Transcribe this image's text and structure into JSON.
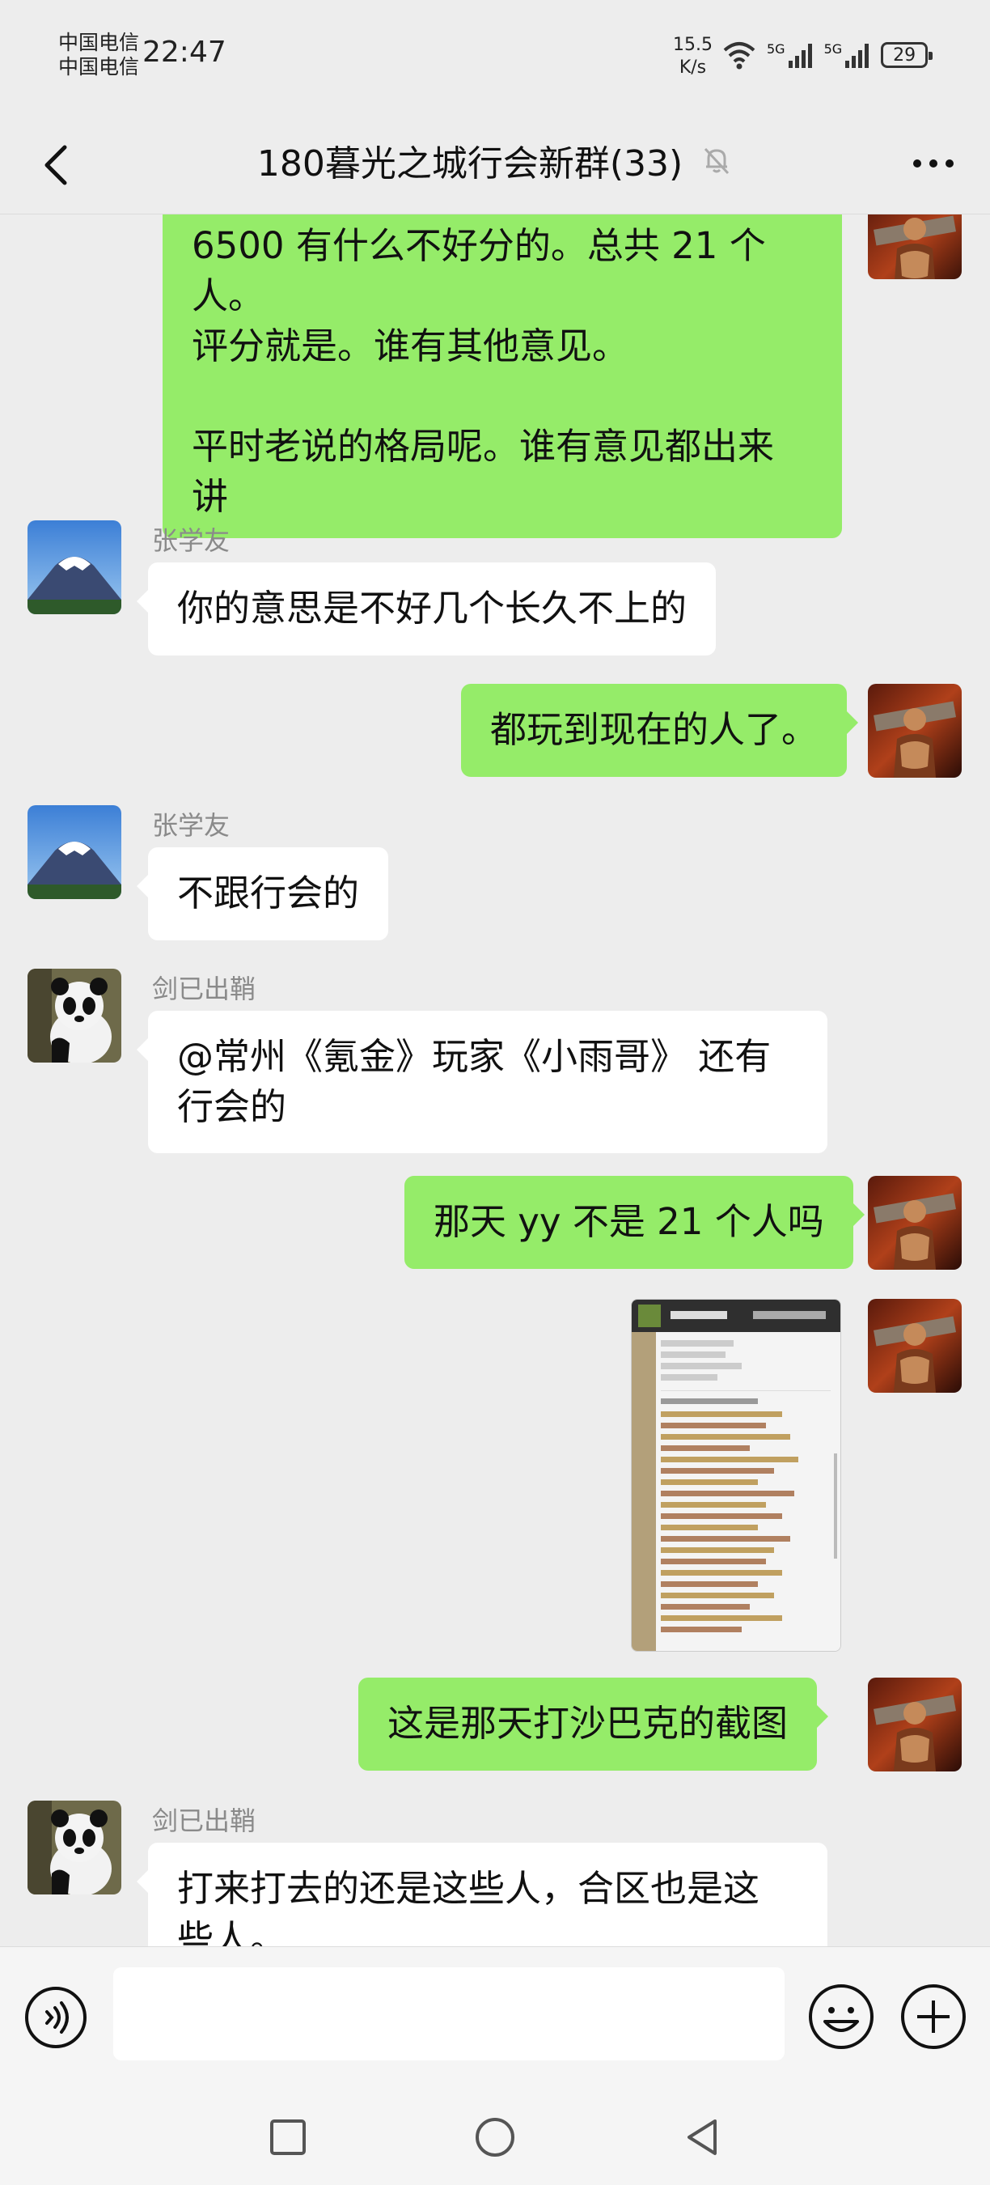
{
  "status_bar": {
    "carrier_1": "中国电信",
    "carrier_2": "中国电信",
    "time": "22:47",
    "net_speed_value": "15.5",
    "net_speed_unit": "K/s",
    "signal_1_label": "5G",
    "signal_2_label": "5G",
    "battery": "29"
  },
  "header": {
    "title": "180暮光之城行会新群(33)",
    "muted_icon": "bell-off-icon",
    "back_icon": "chevron-left-icon",
    "more_icon": "more-dots-icon"
  },
  "messages": [
    {
      "side": "out",
      "lines": [
        "6500 有什么不好分的。总共 21 个人。",
        "评分就是。谁有其他意见。",
        "",
        "平时老说的格局呢。谁有意见都出来",
        "讲"
      ]
    },
    {
      "side": "in",
      "sender": "张学友",
      "lines": [
        "你的意思是不好几个长久不上的"
      ]
    },
    {
      "side": "out",
      "lines": [
        "都玩到现在的人了。"
      ]
    },
    {
      "side": "in",
      "sender": "张学友",
      "lines": [
        "不跟行会的"
      ]
    },
    {
      "side": "in",
      "sender": "剑已出鞘",
      "lines": [
        "@常州《氪金》玩家《小雨哥》 还有",
        "行会的"
      ]
    },
    {
      "side": "out",
      "lines": [
        "那天 yy 不是 21 个人吗"
      ]
    },
    {
      "side": "out",
      "type": "image"
    },
    {
      "side": "out",
      "lines": [
        "这是那天打沙巴克的截图"
      ]
    },
    {
      "side": "in",
      "sender": "剑已出鞘",
      "lines": [
        "打来打去的还是这些人，合区也是这",
        "些人。"
      ]
    }
  ],
  "input_bar": {
    "voice_icon": "voice-icon",
    "emoji_icon": "emoji-icon",
    "plus_icon": "plus-icon"
  },
  "nav_bar": {
    "recent_icon": "square-icon",
    "home_icon": "circle-icon",
    "back_icon": "triangle-back-icon"
  },
  "colors": {
    "outgoing_bubble": "#95ec69",
    "incoming_bubble": "#ffffff",
    "background": "#ededed"
  }
}
